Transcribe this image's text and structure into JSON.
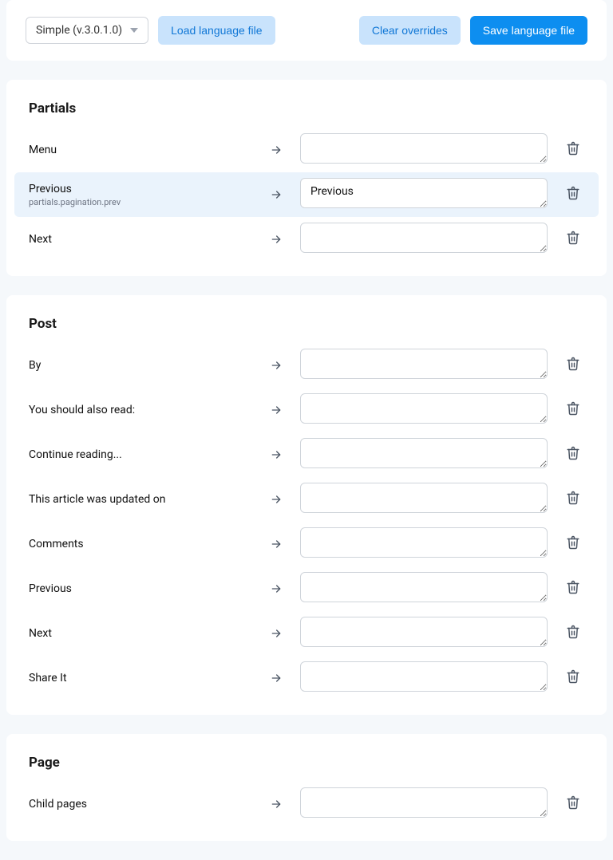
{
  "topbar": {
    "version_select": "Simple (v.3.0.1.0)",
    "load_label": "Load language file",
    "clear_label": "Clear overrides",
    "save_label": "Save language file"
  },
  "sections": [
    {
      "title": "Partials",
      "rows": [
        {
          "label": "Menu",
          "sub": "",
          "value": "",
          "selected": false
        },
        {
          "label": "Previous",
          "sub": "partials.pagination.prev",
          "value": "Previous",
          "selected": true
        },
        {
          "label": "Next",
          "sub": "",
          "value": "",
          "selected": false
        }
      ]
    },
    {
      "title": "Post",
      "rows": [
        {
          "label": "By",
          "sub": "",
          "value": "",
          "selected": false
        },
        {
          "label": "You should also read:",
          "sub": "",
          "value": "",
          "selected": false
        },
        {
          "label": "Continue reading...",
          "sub": "",
          "value": "",
          "selected": false
        },
        {
          "label": "This article was updated on",
          "sub": "",
          "value": "",
          "selected": false
        },
        {
          "label": "Comments",
          "sub": "",
          "value": "",
          "selected": false
        },
        {
          "label": "Previous",
          "sub": "",
          "value": "",
          "selected": false
        },
        {
          "label": "Next",
          "sub": "",
          "value": "",
          "selected": false
        },
        {
          "label": "Share It",
          "sub": "",
          "value": "",
          "selected": false
        }
      ]
    },
    {
      "title": "Page",
      "rows": [
        {
          "label": "Child pages",
          "sub": "",
          "value": "",
          "selected": false
        }
      ]
    }
  ]
}
